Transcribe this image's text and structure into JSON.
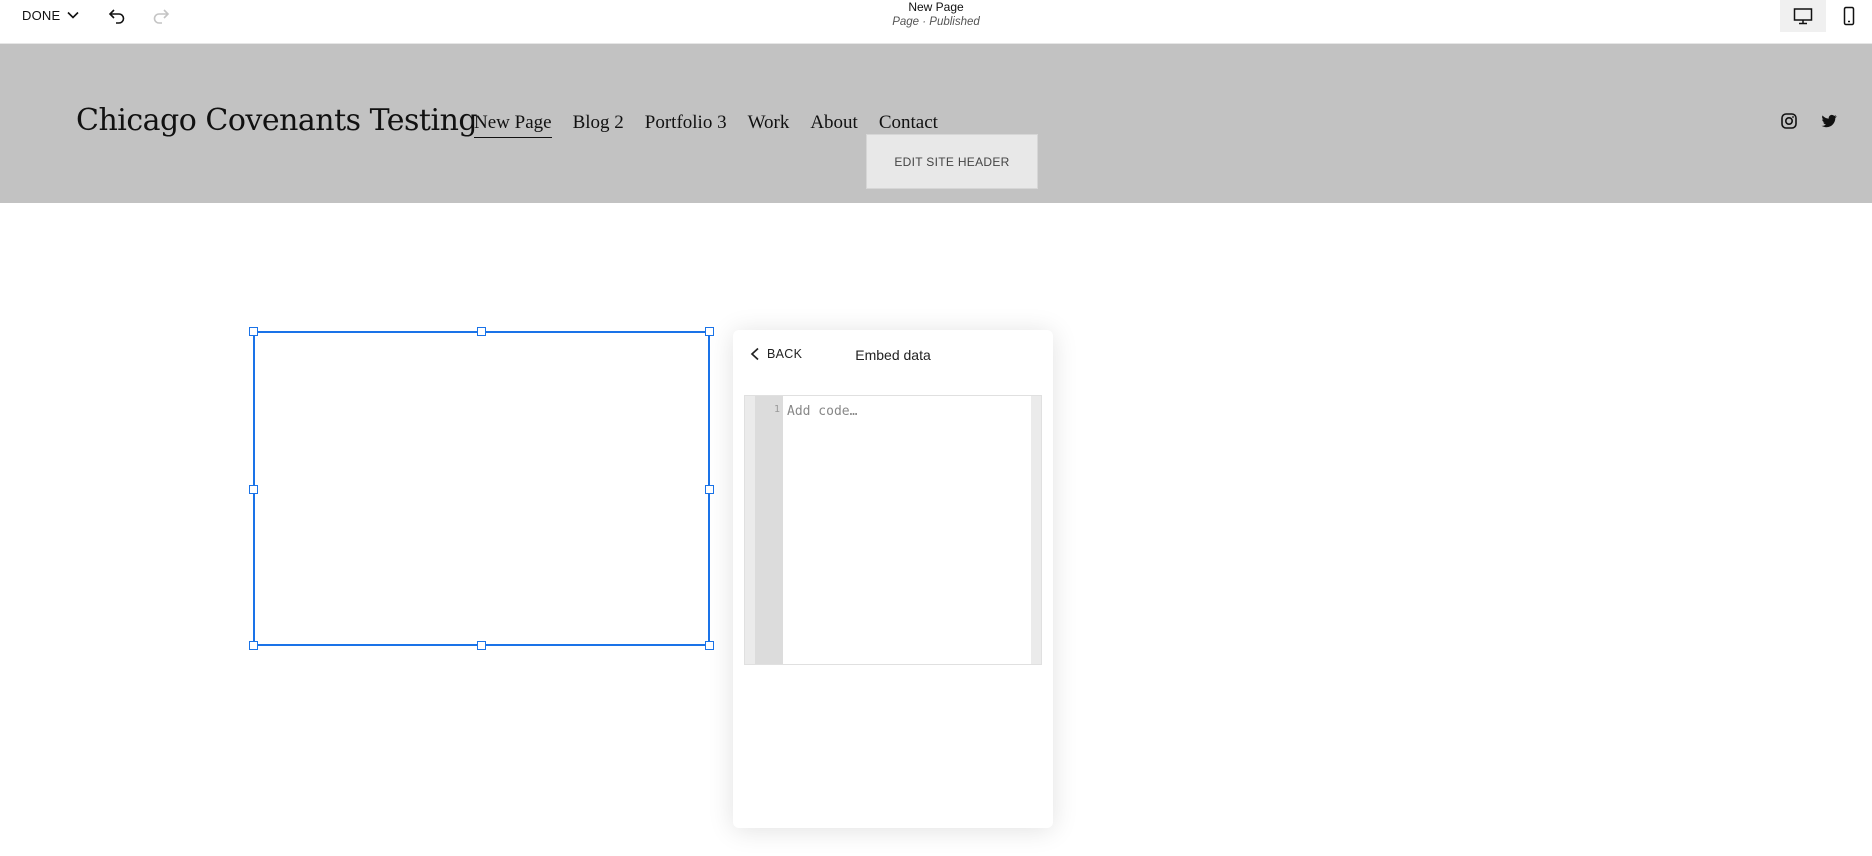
{
  "toolbar": {
    "done_label": "DONE",
    "page_title": "New Page",
    "page_status": "Page · Published",
    "undo_icon": "undo-icon",
    "redo_icon": "redo-icon",
    "desktop_icon": "desktop-icon",
    "mobile_icon": "mobile-icon"
  },
  "site_header": {
    "site_title": "Chicago Covenants Testing",
    "nav": [
      {
        "label": "New Page",
        "active": true
      },
      {
        "label": "Blog 2"
      },
      {
        "label": "Portfolio 3"
      },
      {
        "label": "Work"
      },
      {
        "label": "About"
      },
      {
        "label": "Contact"
      }
    ],
    "edit_button_label": "EDIT SITE HEADER",
    "social_icons": [
      "instagram-icon",
      "twitter-icon"
    ],
    "background_color": "#c2c2c2"
  },
  "embed_panel": {
    "back_label": "BACK",
    "title": "Embed data",
    "line_number": "1",
    "code_placeholder": "Add code…",
    "code_value": ""
  },
  "colors": {
    "selection": "#1a73e8"
  }
}
